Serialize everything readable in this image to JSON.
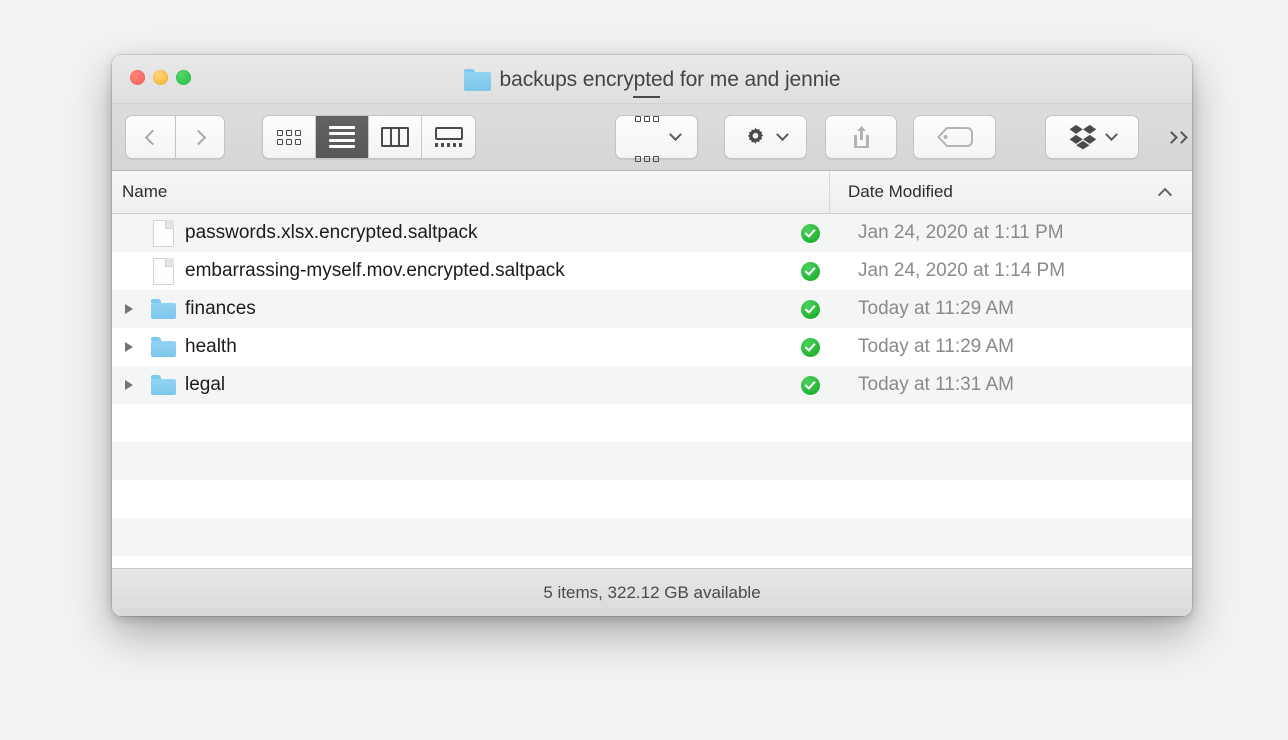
{
  "window": {
    "title": "backups encrypted for me and jennie",
    "title_icon": "folder-icon",
    "traffic_lights": {
      "close": "close-button",
      "minimize": "minimize-button",
      "maximize": "maximize-button",
      "close_color": "#fa5e55",
      "minimize_color": "#f9b726",
      "maximize_color": "#22c13c"
    }
  },
  "toolbar": {
    "back": "back-button",
    "forward": "forward-button",
    "view_modes": [
      {
        "name": "icon-view",
        "icon": "grid-icon",
        "active": false
      },
      {
        "name": "list-view",
        "icon": "list-icon",
        "active": true
      },
      {
        "name": "column-view",
        "icon": "columns-icon",
        "active": false
      },
      {
        "name": "gallery-view",
        "icon": "gallery-icon",
        "active": false
      }
    ],
    "arrange": {
      "name": "arrange-button",
      "icon": "arrange-icon"
    },
    "action": {
      "name": "action-button",
      "icon": "gear-icon"
    },
    "share": {
      "name": "share-button",
      "icon": "share-icon"
    },
    "tags": {
      "name": "tags-button",
      "icon": "tag-icon"
    },
    "dropbox": {
      "name": "dropbox-button",
      "icon": "dropbox-icon"
    },
    "more": {
      "name": "more-toolbar-items-button",
      "icon": "chevron-double-right-icon"
    }
  },
  "columns": {
    "name": "Name",
    "date_modified": "Date Modified",
    "sort_direction": "ascending"
  },
  "files": [
    {
      "name": "passwords.xlsx.encrypted.saltpack",
      "kind": "file",
      "icon": "document-icon",
      "expandable": false,
      "sync_status": "synced",
      "date_modified": "Jan 24, 2020 at 1:11 PM"
    },
    {
      "name": "embarrassing-myself.mov.encrypted.saltpack",
      "kind": "file",
      "icon": "document-icon",
      "expandable": false,
      "sync_status": "synced",
      "date_modified": "Jan 24, 2020 at 1:14 PM"
    },
    {
      "name": "finances",
      "kind": "folder",
      "icon": "folder-icon",
      "expandable": true,
      "sync_status": "synced",
      "date_modified": "Today at 11:29 AM"
    },
    {
      "name": "health",
      "kind": "folder",
      "icon": "folder-icon",
      "expandable": true,
      "sync_status": "synced",
      "date_modified": "Today at 11:29 AM"
    },
    {
      "name": "legal",
      "kind": "folder",
      "icon": "folder-icon",
      "expandable": true,
      "sync_status": "synced",
      "date_modified": "Today at 11:31 AM"
    }
  ],
  "status_bar": {
    "text": "5 items, 322.12 GB available"
  },
  "colors": {
    "folder_blue": "#7cc6ec",
    "sync_green": "#1fb130",
    "selected_segment": "#5c5c5c"
  }
}
